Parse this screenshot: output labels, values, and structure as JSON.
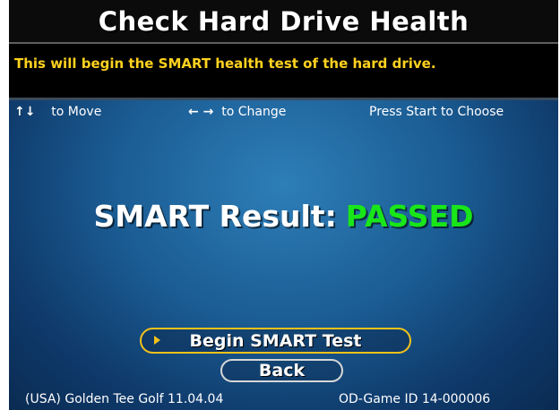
{
  "header": {
    "title": "Check Hard Drive Health",
    "description": "This will begin the SMART health test of the hard drive."
  },
  "hints": {
    "move_icon": "↑↓",
    "move_label": "to Move",
    "change_icon": "← →",
    "change_label": "to Change",
    "choose_label": "Press Start to Choose"
  },
  "result": {
    "label": "SMART Result:",
    "value": "PASSED"
  },
  "menu": {
    "begin_label": "Begin SMART Test",
    "back_label": "Back",
    "selected_icon": "right-triangle-icon"
  },
  "footer": {
    "game_info": "(USA) Golden Tee Golf 11.04.04",
    "game_id": "OD-Game ID 14-000006"
  },
  "colors": {
    "title_bg": "#0b0b0b",
    "info_text": "#ffd21f",
    "result_pass": "#19e619",
    "selected_border": "#f2c21a",
    "button_border": "#d7d7d7",
    "background": "#1a5b92"
  }
}
